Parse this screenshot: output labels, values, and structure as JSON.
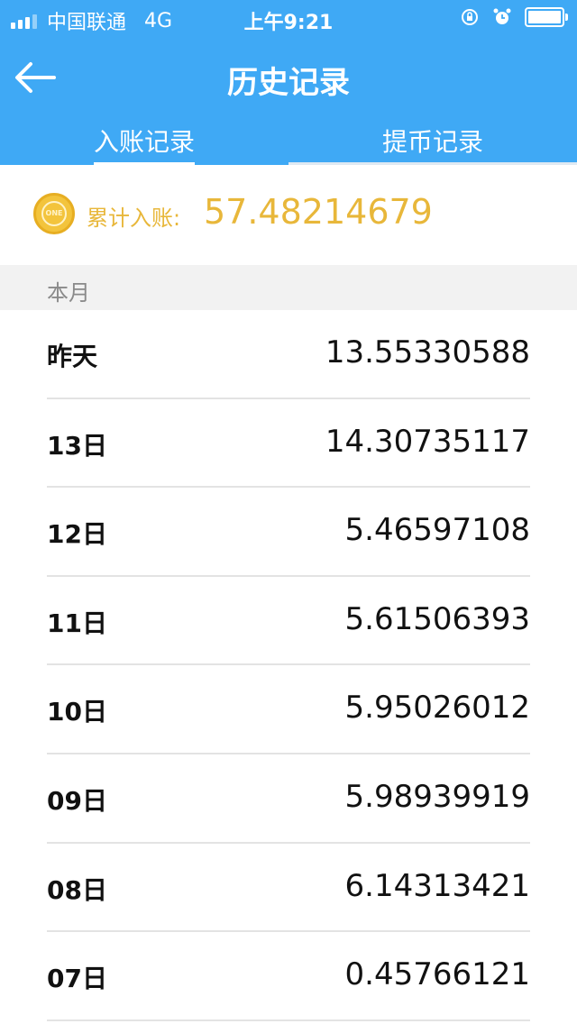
{
  "status_bar": {
    "carrier": "中国联通",
    "network": "4G",
    "time": "上午9:21"
  },
  "navbar": {
    "title": "历史记录",
    "back_icon": "arrow-left-icon"
  },
  "tabs": [
    {
      "label": "入账记录",
      "active": true
    },
    {
      "label": "提币记录",
      "active": false
    }
  ],
  "summary": {
    "coin_icon": "one-coin-icon",
    "coin_text": "ONE",
    "label": "累计入账:",
    "value": "57.48214679"
  },
  "section": {
    "title": "本月"
  },
  "records": [
    {
      "date": "昨天",
      "amount": "13.55330588"
    },
    {
      "date": "13日",
      "amount": "14.30735117"
    },
    {
      "date": "12日",
      "amount": "5.46597108"
    },
    {
      "date": "11日",
      "amount": "5.61506393"
    },
    {
      "date": "10日",
      "amount": "5.95026012"
    },
    {
      "date": "09日",
      "amount": "5.98939919"
    },
    {
      "date": "08日",
      "amount": "6.14313421"
    },
    {
      "date": "07日",
      "amount": "0.45766121"
    }
  ],
  "colors": {
    "header": "#3fa9f5",
    "accent_gold": "#e8b73a"
  }
}
